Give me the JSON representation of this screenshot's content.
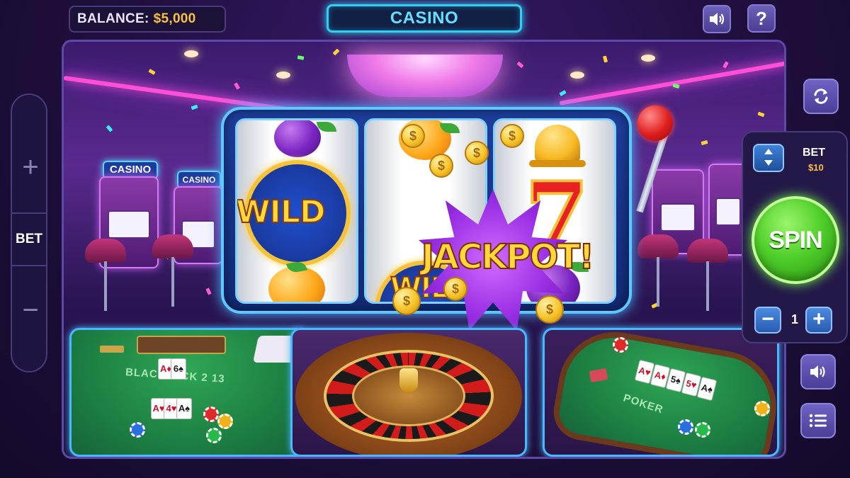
{
  "header": {
    "balance_label": "BALANCE:",
    "balance_value": "$5,000",
    "title": "CASINO"
  },
  "top_icons": [
    "speaker-icon",
    "help-icon"
  ],
  "help_glyph": "?",
  "left_rail": {
    "plus_glyph": "+",
    "label": "BET",
    "minus_glyph": "−"
  },
  "scene": {
    "side_machine_sign_left": "CASINO",
    "side_machine_sign_right": "CASINO",
    "reels": [
      {
        "top": "plum",
        "middle": "wild",
        "bottom": "orange"
      },
      {
        "top": "orange",
        "middle": "jackpot-burst",
        "bottom": "wild"
      },
      {
        "top": "bell",
        "middle": "seven",
        "bottom": "plum"
      }
    ],
    "wild_text": "WILD",
    "seven_text": "7",
    "jackpot_text": "JACKPOT!",
    "coin_symbol": "$"
  },
  "tables": {
    "blackjack_label": "BLACKJACK 2 13",
    "poker_label": "POKER",
    "blackjack_cards": [
      "A♦",
      "6♠",
      "A♥",
      "4♥",
      "A♠"
    ],
    "poker_cards": [
      "A♥",
      "A♦",
      "5♠",
      "5♥",
      "A♠"
    ]
  },
  "right_panel": {
    "bet_label": "BET",
    "bet_value": "$10",
    "spin_label": "SPIN",
    "quantity": "1",
    "minus_glyph": "−",
    "plus_glyph": "+"
  },
  "side_icons": [
    "refresh-icon",
    "sound-icon",
    "menu-icon"
  ],
  "colors": {
    "accent_cyan": "#2fd0f2",
    "balance_gold": "#f6c142",
    "spin_green": "#4fcf2a",
    "panel_purple": "#241849"
  }
}
